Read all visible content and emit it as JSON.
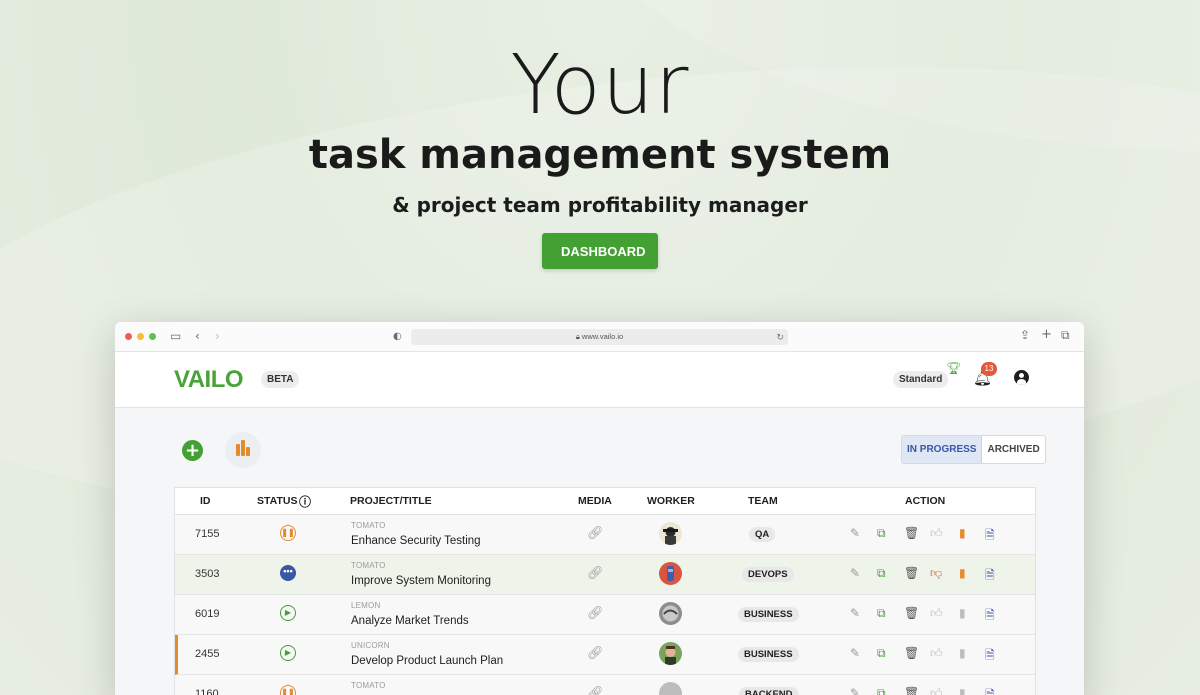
{
  "hero": {
    "headline_big": "Your",
    "headline_mid": "task management system",
    "subheadline": "& project team profitability manager",
    "cta_label": "DASHBOARD"
  },
  "browser": {
    "url": "www.vailo.io"
  },
  "app": {
    "logo": "VAILO",
    "beta_label": "BETA",
    "plan_label": "Standard",
    "notification_count": "13"
  },
  "filters": {
    "in_progress": "IN PROGRESS",
    "archived": "ARCHIVED",
    "active": "in_progress"
  },
  "table": {
    "headers": {
      "id": "ID",
      "status": "STATUS",
      "project_title": "PROJECT/TITLE",
      "media": "MEDIA",
      "worker": "WORKER",
      "team": "TEAM",
      "action": "ACTION"
    },
    "rows": [
      {
        "id": "7155",
        "status": "paused",
        "project": "TOMATO",
        "title": "Enhance Security Testing",
        "team": "QA"
      },
      {
        "id": "3503",
        "status": "pending",
        "project": "TOMATO",
        "title": "Improve System Monitoring",
        "team": "DEVOPS"
      },
      {
        "id": "6019",
        "status": "playing",
        "project": "LEMON",
        "title": "Analyze Market Trends",
        "team": "BUSINESS"
      },
      {
        "id": "2455",
        "status": "playing",
        "project": "UNICORN",
        "title": "Develop Product Launch Plan",
        "team": "BUSINESS"
      },
      {
        "id": "1160",
        "status": "paused",
        "project": "TOMATO",
        "title": "",
        "team": "BACKEND"
      }
    ]
  },
  "colors": {
    "brand_green": "#43a033",
    "accent_orange": "#e48b2b",
    "accent_blue": "#3a57a5",
    "danger_red": "#e15a3a"
  }
}
